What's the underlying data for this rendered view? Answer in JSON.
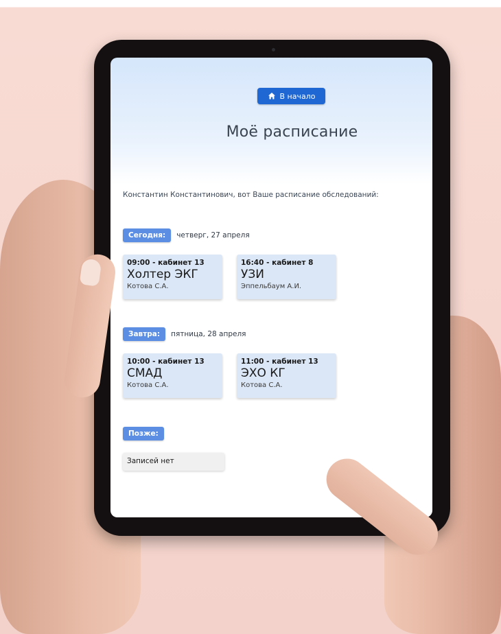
{
  "header": {
    "home_button_label": "В начало",
    "home_icon": "home-icon",
    "title": "Моё расписание"
  },
  "intro_text": "Константин Константинович, вот Ваше расписание обследований:",
  "sections": {
    "today": {
      "tag": "Сегодня:",
      "date": "четверг, 27 апреля",
      "items": [
        {
          "time": "09:00 - кабинет 13",
          "procedure": "Холтер ЭКГ",
          "doctor": "Котова С.А."
        },
        {
          "time": "16:40 - кабинет 8",
          "procedure": "УЗИ",
          "doctor": "Эппельбаум А.И."
        }
      ]
    },
    "tomorrow": {
      "tag": "Завтра:",
      "date": "пятница, 28 апреля",
      "items": [
        {
          "time": "10:00 - кабинет 13",
          "procedure": "СМАД",
          "doctor": "Котова С.А."
        },
        {
          "time": "11:00 - кабинет 13",
          "procedure": "ЭХО КГ",
          "doctor": "Котова С.А."
        }
      ]
    },
    "later": {
      "tag": "Позже:",
      "empty_text": "Записей нет"
    }
  },
  "colors": {
    "primary_button": "#1f67d2",
    "tag": "#5c8fe3",
    "card": "#dbe7f6"
  }
}
